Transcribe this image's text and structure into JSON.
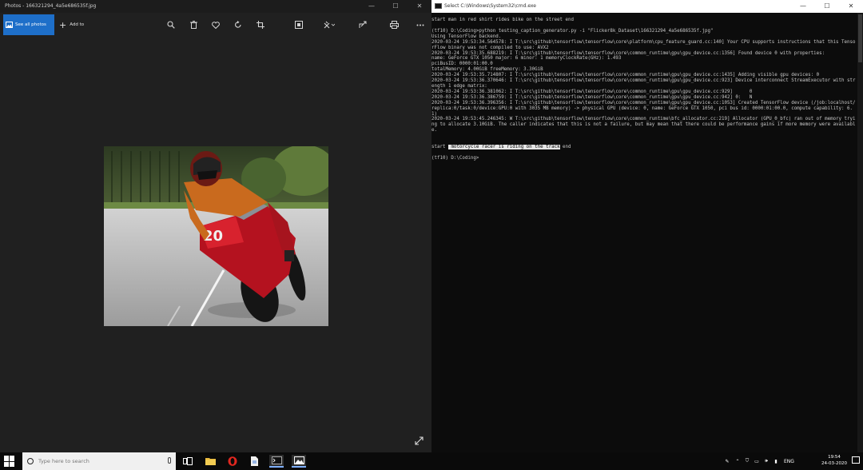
{
  "photos": {
    "title": "Photos - 166321294_4a5e686535f.jpg",
    "toolbar": {
      "see_all_label": "See all photos",
      "add_to_label": "Add to",
      "icons": [
        "zoom-icon",
        "delete-icon",
        "heart-icon",
        "rotate-icon",
        "crop-icon",
        "fullscreen-icon",
        "edit-icon",
        "share-icon",
        "print-icon",
        "more-icon"
      ]
    },
    "window_buttons": [
      "—",
      "☐",
      "✕"
    ]
  },
  "cmd": {
    "title": "Select C:\\Windows\\System32\\cmd.exe",
    "lines": [
      "start man in red shirt rides bike on the street end",
      "",
      "(tf10) D:\\Coding>python testing_caption_generator.py -i \"Flicker8k_Dataset\\166321294_4a5e686535f.jpg\"",
      "Using TensorFlow backend.",
      "2020-03-24 19:53:34.564578: I T:\\src\\github\\tensorflow\\tensorflow\\core\\platform\\cpu_feature_guard.cc:140] Your CPU supports instructions that this TensorFlow binary was not compiled to use: AVX2",
      "2020-03-24 19:53:35.688219: I T:\\src\\github\\tensorflow\\tensorflow\\core\\common_runtime\\gpu\\gpu_device.cc:1356] Found device 0 with properties:",
      "name: GeForce GTX 1050 major: 6 minor: 1 memoryClockRate(GHz): 1.493",
      "pciBusID: 0000:01:00.0",
      "totalMemory: 4.00GiB freeMemory: 3.30GiB",
      "2020-03-24 19:53:35.714807: I T:\\src\\github\\tensorflow\\tensorflow\\core\\common_runtime\\gpu\\gpu_device.cc:1435] Adding visible gpu devices: 0",
      "2020-03-24 19:53:36.370646: I T:\\src\\github\\tensorflow\\tensorflow\\core\\common_runtime\\gpu\\gpu_device.cc:923] Device interconnect StreamExecutor with strength 1 edge matrix:",
      "2020-03-24 19:53:36.381062: I T:\\src\\github\\tensorflow\\tensorflow\\core\\common_runtime\\gpu\\gpu_device.cc:929]      0",
      "2020-03-24 19:53:36.386759: I T:\\src\\github\\tensorflow\\tensorflow\\core\\common_runtime\\gpu\\gpu_device.cc:942] 0:   N",
      "2020-03-24 19:53:36.396356: I T:\\src\\github\\tensorflow\\tensorflow\\core\\common_runtime\\gpu\\gpu_device.cc:1053] Created TensorFlow device (/job:localhost/replica:0/task:0/device:GPU:0 with 3035 MB memory) -> physical GPU (device: 0, name: GeForce GTX 1050, pci bus id: 0000:01:00.0, compute capability: 6.1)",
      "2020-03-24 19:53:45.246345: W T:\\src\\github\\tensorflow\\tensorflow\\core\\common_runtime\\bfc_allocator.cc:219] Allocator (GPU_0_bfc) ran out of memory trying to allocate 3.10GiB. The caller indicates that this is not a failure, but may mean that there could be performance gains if more memory were available."
    ],
    "result": {
      "prefix": "start ",
      "caption": " motorcycle racer is riding on the track",
      "suffix": " end"
    },
    "prompt": "(tf10) D:\\Coding>",
    "window_buttons": [
      "—",
      "☐",
      "✕"
    ]
  },
  "taskbar": {
    "search_placeholder": "Type here to search",
    "apps": [
      "task-view-icon",
      "file-explorer-icon",
      "opera-icon",
      "files-icon",
      "cmd-app-icon",
      "photos-app-icon"
    ],
    "tray_language": "ENG",
    "time": "19:54",
    "date": "24-03-2020"
  },
  "colors": {
    "accent": "#1e6fc9",
    "console_bg": "#0c0c0c",
    "console_text": "#c8c8c8",
    "opera_red": "#e0271f"
  }
}
